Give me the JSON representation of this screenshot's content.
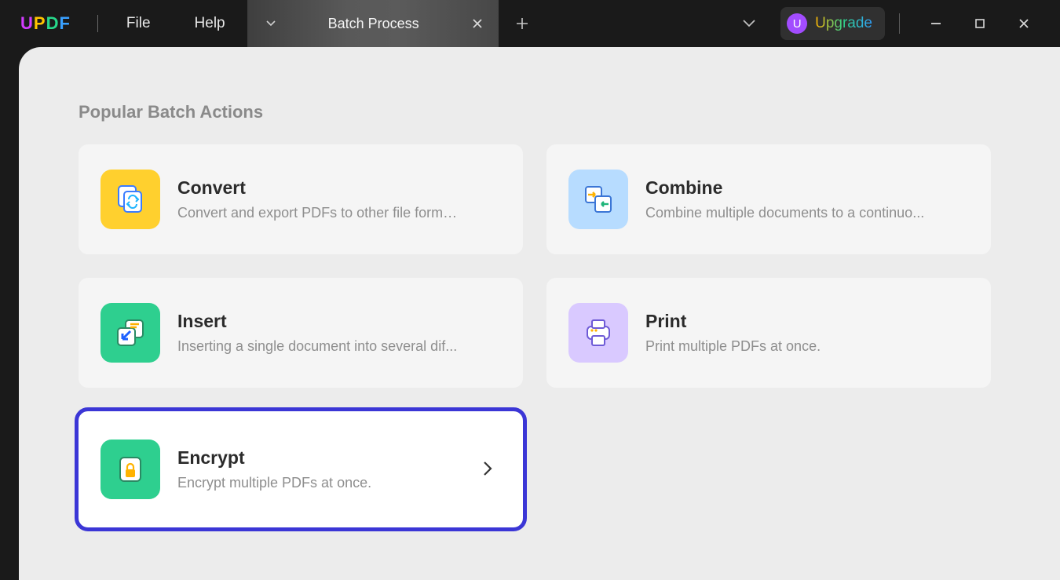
{
  "app": {
    "logo": {
      "u": "U",
      "p": "P",
      "d": "D",
      "f": "F"
    }
  },
  "menu": {
    "file": "File",
    "help": "Help"
  },
  "tabs": {
    "active": {
      "label": "Batch Process"
    }
  },
  "upgrade": {
    "avatar_letter": "U",
    "label": "Upgrade"
  },
  "section": {
    "title": "Popular Batch Actions"
  },
  "cards": {
    "convert": {
      "title": "Convert",
      "desc": "Convert and export PDFs to other file forma..."
    },
    "combine": {
      "title": "Combine",
      "desc": "Combine multiple documents to a continuo..."
    },
    "insert": {
      "title": "Insert",
      "desc": "Inserting a single document into several dif..."
    },
    "print": {
      "title": "Print",
      "desc": "Print multiple PDFs at once."
    },
    "encrypt": {
      "title": "Encrypt",
      "desc": "Encrypt multiple PDFs at once."
    }
  }
}
